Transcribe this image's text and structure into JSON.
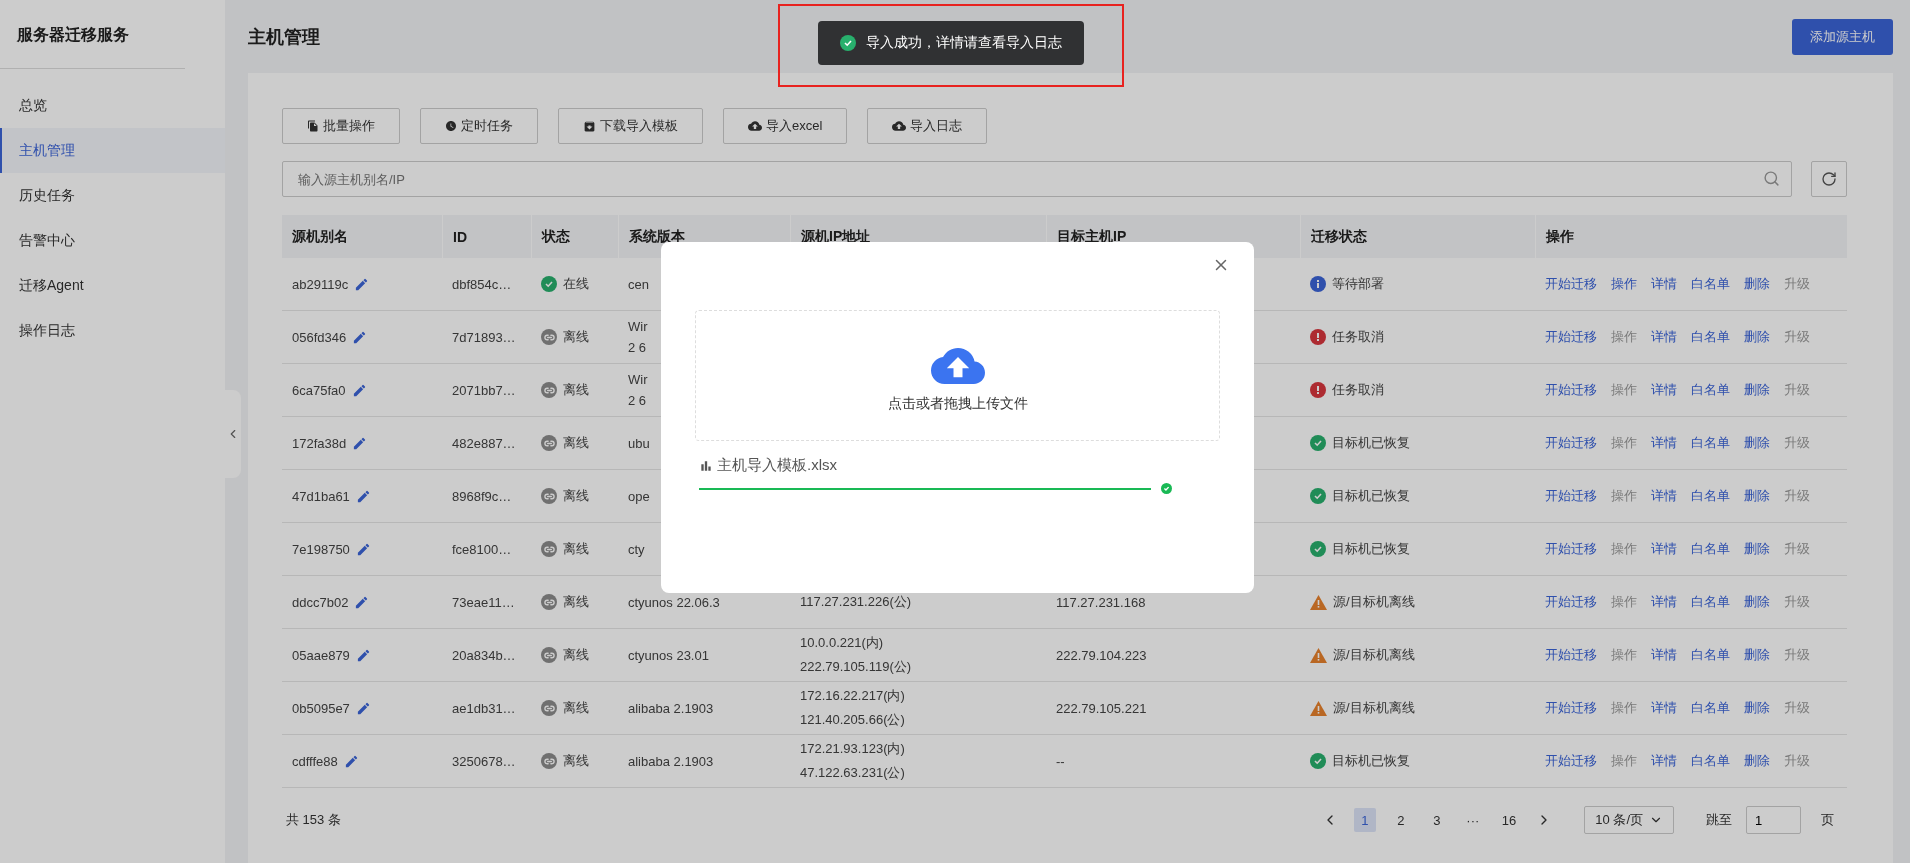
{
  "sidebar": {
    "title": "服务器迁移服务",
    "items": [
      {
        "label": "总览",
        "selected": false
      },
      {
        "label": "主机管理",
        "selected": true
      },
      {
        "label": "历史任务",
        "selected": false
      },
      {
        "label": "告警中心",
        "selected": false
      },
      {
        "label": "迁移Agent",
        "selected": false
      },
      {
        "label": "操作日志",
        "selected": false
      }
    ]
  },
  "header": {
    "title": "主机管理",
    "add_button": "添加源主机"
  },
  "toolbar": [
    {
      "label": "批量操作",
      "kind": "batch"
    },
    {
      "label": "定时任务",
      "kind": "schedule"
    },
    {
      "label": "下载导入模板",
      "kind": "download"
    },
    {
      "label": "导入excel",
      "kind": "import"
    },
    {
      "label": "导入日志",
      "kind": "import"
    }
  ],
  "search": {
    "placeholder": "输入源主机别名/IP"
  },
  "table": {
    "columns": [
      "源机别名",
      "ID",
      "状态",
      "系统版本",
      "源机IP地址",
      "目标主机IP",
      "迁移状态",
      "操作"
    ],
    "rows": [
      {
        "alias": "ab29119c",
        "id": "dbf854c…",
        "online": true,
        "status": "在线",
        "system": [
          "cen"
        ],
        "source_ip": [],
        "migration": {
          "kind": "info",
          "label": "等待部署"
        },
        "actions": [
          {
            "label": "开始迁移",
            "disabled": false
          },
          {
            "label": "操作",
            "disabled": false
          },
          {
            "label": "详情",
            "disabled": false
          },
          {
            "label": "白名单",
            "disabled": false
          },
          {
            "label": "删除",
            "disabled": false
          },
          {
            "label": "升级",
            "disabled": true
          }
        ]
      },
      {
        "alias": "056fd346",
        "id": "7d71893…",
        "online": false,
        "status": "离线",
        "system": [
          "Wir",
          "2 6"
        ],
        "source_ip": [],
        "migration": {
          "kind": "error",
          "label": "任务取消"
        },
        "actions": [
          {
            "label": "开始迁移",
            "disabled": false
          },
          {
            "label": "操作",
            "disabled": true
          },
          {
            "label": "详情",
            "disabled": false
          },
          {
            "label": "白名单",
            "disabled": false
          },
          {
            "label": "删除",
            "disabled": false
          },
          {
            "label": "升级",
            "disabled": true
          }
        ]
      },
      {
        "alias": "6ca75fa0",
        "id": "2071bb7…",
        "online": false,
        "status": "离线",
        "system": [
          "Wir",
          "2 6"
        ],
        "source_ip": [],
        "migration": {
          "kind": "error",
          "label": "任务取消"
        },
        "actions": [
          {
            "label": "开始迁移",
            "disabled": false
          },
          {
            "label": "操作",
            "disabled": true
          },
          {
            "label": "详情",
            "disabled": false
          },
          {
            "label": "白名单",
            "disabled": false
          },
          {
            "label": "删除",
            "disabled": false
          },
          {
            "label": "升级",
            "disabled": true
          }
        ]
      },
      {
        "alias": "172fa38d",
        "id": "482e887…",
        "online": false,
        "status": "离线",
        "system": [
          "ubu"
        ],
        "source_ip": [],
        "migration": {
          "kind": "success",
          "label": "目标机已恢复"
        },
        "actions": [
          {
            "label": "开始迁移",
            "disabled": false
          },
          {
            "label": "操作",
            "disabled": true
          },
          {
            "label": "详情",
            "disabled": false
          },
          {
            "label": "白名单",
            "disabled": false
          },
          {
            "label": "删除",
            "disabled": false
          },
          {
            "label": "升级",
            "disabled": true
          }
        ]
      },
      {
        "alias": "47d1ba61",
        "id": "8968f9c…",
        "online": false,
        "status": "离线",
        "system": [
          "ope"
        ],
        "source_ip": [],
        "migration": {
          "kind": "success",
          "label": "目标机已恢复"
        },
        "actions": [
          {
            "label": "开始迁移",
            "disabled": false
          },
          {
            "label": "操作",
            "disabled": true
          },
          {
            "label": "详情",
            "disabled": false
          },
          {
            "label": "白名单",
            "disabled": false
          },
          {
            "label": "删除",
            "disabled": false
          },
          {
            "label": "升级",
            "disabled": true
          }
        ]
      },
      {
        "alias": "7e198750",
        "id": "fce8100…",
        "online": false,
        "status": "离线",
        "system": [
          "cty"
        ],
        "source_ip": [],
        "migration": {
          "kind": "success",
          "label": "目标机已恢复"
        },
        "actions": [
          {
            "label": "开始迁移",
            "disabled": false
          },
          {
            "label": "操作",
            "disabled": true
          },
          {
            "label": "详情",
            "disabled": false
          },
          {
            "label": "白名单",
            "disabled": false
          },
          {
            "label": "删除",
            "disabled": false
          },
          {
            "label": "升级",
            "disabled": true
          }
        ]
      },
      {
        "alias": "ddcc7b02",
        "id": "73eae11…",
        "online": false,
        "status": "离线",
        "system": [
          "ctyunos 22.06.3"
        ],
        "source_ip": [
          "117.27.231.226(公)"
        ],
        "target_ip": "117.27.231.168",
        "migration": {
          "kind": "warning",
          "label": "源/目标机离线"
        },
        "actions": [
          {
            "label": "开始迁移",
            "disabled": false
          },
          {
            "label": "操作",
            "disabled": true
          },
          {
            "label": "详情",
            "disabled": false
          },
          {
            "label": "白名单",
            "disabled": false
          },
          {
            "label": "删除",
            "disabled": false
          },
          {
            "label": "升级",
            "disabled": true
          }
        ]
      },
      {
        "alias": "05aae879",
        "id": "20a834b…",
        "online": false,
        "status": "离线",
        "system": [
          "ctyunos 23.01"
        ],
        "source_ip": [
          "10.0.0.221(内)",
          "222.79.105.119(公)"
        ],
        "target_ip": "222.79.104.223",
        "migration": {
          "kind": "warning",
          "label": "源/目标机离线"
        },
        "actions": [
          {
            "label": "开始迁移",
            "disabled": false
          },
          {
            "label": "操作",
            "disabled": true
          },
          {
            "label": "详情",
            "disabled": false
          },
          {
            "label": "白名单",
            "disabled": false
          },
          {
            "label": "删除",
            "disabled": false
          },
          {
            "label": "升级",
            "disabled": true
          }
        ]
      },
      {
        "alias": "0b5095e7",
        "id": "ae1db31…",
        "online": false,
        "status": "离线",
        "system": [
          "alibaba 2.1903"
        ],
        "source_ip": [
          "172.16.22.217(内)",
          "121.40.205.66(公)"
        ],
        "target_ip": "222.79.105.221",
        "migration": {
          "kind": "warning",
          "label": "源/目标机离线"
        },
        "actions": [
          {
            "label": "开始迁移",
            "disabled": false
          },
          {
            "label": "操作",
            "disabled": true
          },
          {
            "label": "详情",
            "disabled": false
          },
          {
            "label": "白名单",
            "disabled": false
          },
          {
            "label": "删除",
            "disabled": false
          },
          {
            "label": "升级",
            "disabled": true
          }
        ]
      },
      {
        "alias": "cdfffe88",
        "id": "3250678…",
        "online": false,
        "status": "离线",
        "system": [
          "alibaba 2.1903"
        ],
        "source_ip": [
          "172.21.93.123(内)",
          "47.122.63.231(公)"
        ],
        "target_ip": "--",
        "migration": {
          "kind": "success",
          "label": "目标机已恢复"
        },
        "actions": [
          {
            "label": "开始迁移",
            "disabled": false
          },
          {
            "label": "操作",
            "disabled": true
          },
          {
            "label": "详情",
            "disabled": false
          },
          {
            "label": "白名单",
            "disabled": false
          },
          {
            "label": "删除",
            "disabled": false
          },
          {
            "label": "升级",
            "disabled": true
          }
        ]
      }
    ]
  },
  "pagination": {
    "total": "共 153 条",
    "pages": [
      {
        "label": "1",
        "selected": true
      },
      {
        "label": "2",
        "selected": false
      },
      {
        "label": "3",
        "selected": false
      },
      {
        "label": "···",
        "selected": false
      },
      {
        "label": "16",
        "selected": false
      }
    ],
    "page_size": "10 条/页",
    "jump_label": "跳至",
    "jump_value": "1",
    "page_suffix": "页"
  },
  "modal": {
    "upload_hint": "点击或者拖拽上传文件",
    "file": {
      "name": "主机导入模板.xlsx",
      "level": 1,
      "done": true
    }
  },
  "toast": {
    "message": "导入成功，详情请查看导入日志",
    "highlighted": true
  }
}
